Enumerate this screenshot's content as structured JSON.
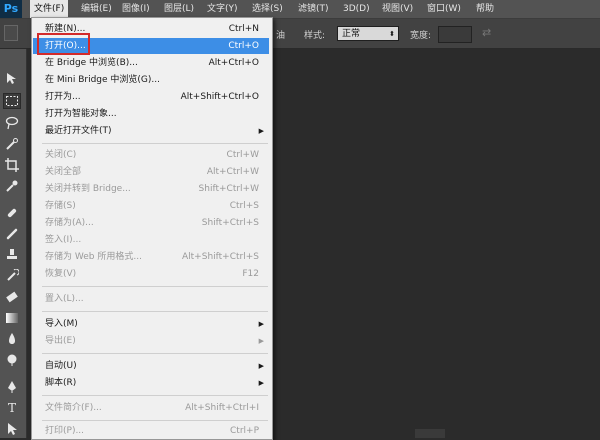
{
  "menubar": {
    "logo": "Ps",
    "items": [
      {
        "label": "文件(F)",
        "active": true
      },
      {
        "label": "编辑(E)"
      },
      {
        "label": "图像(I)"
      },
      {
        "label": "图层(L)"
      },
      {
        "label": "文字(Y)"
      },
      {
        "label": "选择(S)"
      },
      {
        "label": "滤镜(T)"
      },
      {
        "label": "3D(D)"
      },
      {
        "label": "视图(V)"
      },
      {
        "label": "窗口(W)"
      },
      {
        "label": "帮助"
      }
    ]
  },
  "options": {
    "partial_label": "油",
    "style_label": "样式:",
    "style_value": "正常",
    "width_label": "宽度:"
  },
  "file_menu": {
    "items": [
      {
        "label": "新建(N)...",
        "shortcut": "Ctrl+N"
      },
      {
        "label": "打开(O)...",
        "shortcut": "Ctrl+O",
        "highlighted": true
      },
      {
        "label": "在 Bridge 中浏览(B)...",
        "shortcut": "Alt+Ctrl+O"
      },
      {
        "label": "在 Mini Bridge 中浏览(G)..."
      },
      {
        "label": "打开为...",
        "shortcut": "Alt+Shift+Ctrl+O"
      },
      {
        "label": "打开为智能对象..."
      },
      {
        "label": "最近打开文件(T)",
        "submenu": true
      },
      {
        "label": "关闭(C)",
        "shortcut": "Ctrl+W",
        "disabled": true
      },
      {
        "label": "关闭全部",
        "shortcut": "Alt+Ctrl+W",
        "disabled": true
      },
      {
        "label": "关闭并转到 Bridge...",
        "shortcut": "Shift+Ctrl+W",
        "disabled": true
      },
      {
        "label": "存储(S)",
        "shortcut": "Ctrl+S",
        "disabled": true
      },
      {
        "label": "存储为(A)...",
        "shortcut": "Shift+Ctrl+S",
        "disabled": true
      },
      {
        "label": "签入(I)...",
        "disabled": true
      },
      {
        "label": "存储为 Web 所用格式...",
        "shortcut": "Alt+Shift+Ctrl+S",
        "disabled": true
      },
      {
        "label": "恢复(V)",
        "shortcut": "F12",
        "disabled": true
      },
      {
        "label": "置入(L)...",
        "disabled": true
      },
      {
        "label": "导入(M)",
        "submenu": true
      },
      {
        "label": "导出(E)",
        "submenu": true,
        "disabled": true
      },
      {
        "label": "自动(U)",
        "submenu": true
      },
      {
        "label": "脚本(R)",
        "submenu": true
      },
      {
        "label": "文件简介(F)...",
        "shortcut": "Alt+Shift+Ctrl+I",
        "disabled": true
      },
      {
        "label": "打印(P)...",
        "shortcut": "Ctrl+P",
        "disabled": true
      }
    ]
  },
  "colors": {
    "highlight": "#3d8ee6",
    "annotation_box": "#d32a2a",
    "menubar_bg": "#535353",
    "canvas_bg": "#2b2b2b"
  },
  "icons": {
    "submenu_arrow": "▶"
  }
}
